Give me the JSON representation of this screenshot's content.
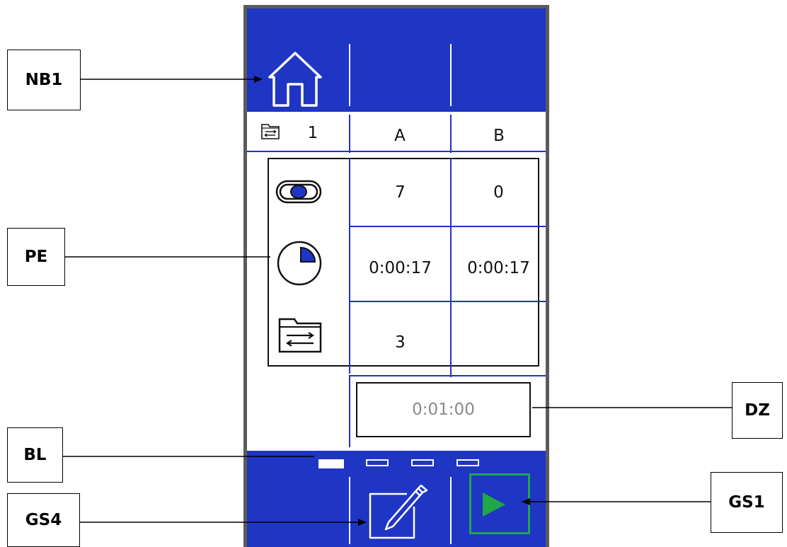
{
  "callouts": {
    "nb1": "NB1",
    "pe": "PE",
    "dz": "DZ",
    "bl": "BL",
    "gs4": "GS4",
    "gs1": "GS1"
  },
  "header": {
    "program_number": "1",
    "col_a": "A",
    "col_b": "B"
  },
  "rows": {
    "count": {
      "icon": "toggle-switch-icon",
      "a": "7",
      "b": "0"
    },
    "time": {
      "icon": "pie-timer-icon",
      "a": "0:00:17",
      "b": "0:00:17"
    },
    "program": {
      "icon": "folder-swap-icon",
      "a": "3",
      "b": ""
    }
  },
  "total_time": "0:01:00",
  "page_indicator": {
    "pages": 4,
    "active": 1
  },
  "icons": {
    "home": "home-icon",
    "edit": "edit-icon",
    "play": "play-icon",
    "folder_small": "folder-swap-small-icon"
  },
  "colors": {
    "brand_blue": "#1f35c4",
    "play_green": "#1fa84a",
    "timer_text": "#8a8a8a"
  }
}
